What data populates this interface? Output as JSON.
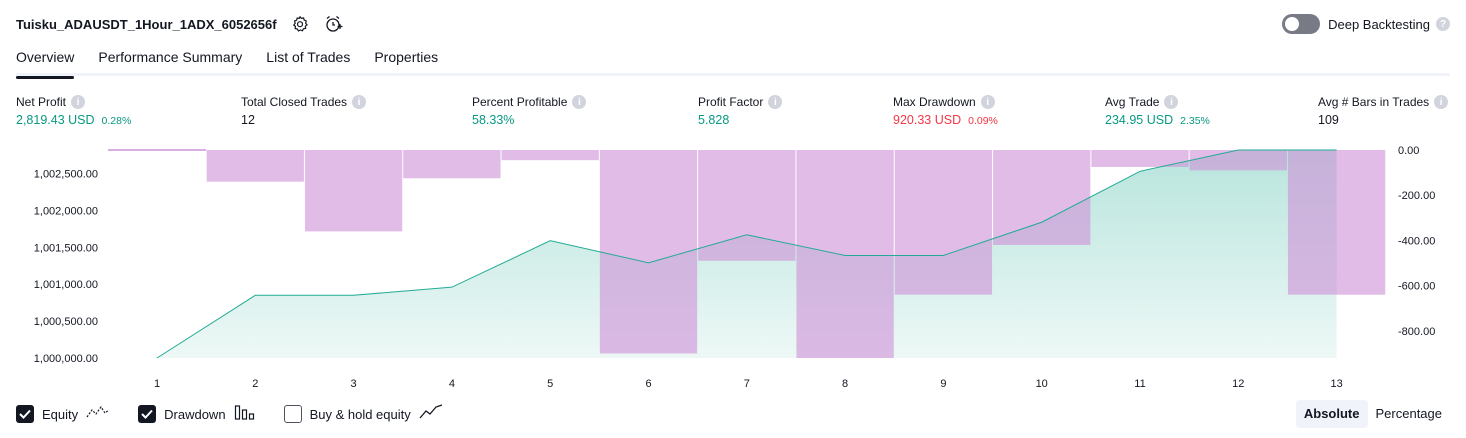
{
  "header": {
    "title": "Tuisku_ADAUSDT_1Hour_1ADX_6052656f",
    "settings_icon": "settings-gear-icon",
    "alert_icon": "add-alert-clock-icon"
  },
  "deep_backtesting": {
    "label": "Deep Backtesting",
    "enabled": false,
    "help": "?"
  },
  "tabs": [
    {
      "label": "Overview",
      "active": true
    },
    {
      "label": "Performance Summary",
      "active": false
    },
    {
      "label": "List of Trades",
      "active": false
    },
    {
      "label": "Properties",
      "active": false
    }
  ],
  "metrics": {
    "net_profit": {
      "label": "Net Profit",
      "value": "2,819.43 USD",
      "percent": "0.28%",
      "info": "i"
    },
    "total_closed_trades": {
      "label": "Total Closed Trades",
      "value": "12",
      "info": "i"
    },
    "percent_profitable": {
      "label": "Percent Profitable",
      "value": "58.33%",
      "info": "i"
    },
    "profit_factor": {
      "label": "Profit Factor",
      "value": "5.828",
      "info": "i"
    },
    "max_drawdown": {
      "label": "Max Drawdown",
      "value": "920.33 USD",
      "percent": "0.09%",
      "info": "i"
    },
    "avg_trade": {
      "label": "Avg Trade",
      "value": "234.95 USD",
      "percent": "2.35%",
      "info": "i"
    },
    "avg_bars": {
      "label": "Avg # Bars in Trades",
      "value": "109",
      "info": "i"
    }
  },
  "colors": {
    "positive": "#089981",
    "negative": "#f23645",
    "equity_line": "#22ab94",
    "drawdown_bar": "#ce93d8"
  },
  "chart_data": {
    "type": "area",
    "x": [
      1,
      2,
      3,
      4,
      5,
      6,
      7,
      8,
      9,
      10,
      11,
      12,
      13
    ],
    "series": [
      {
        "name": "Equity",
        "type": "area",
        "axis": "left",
        "values": [
          1000000,
          1000850,
          1000850,
          1000960,
          1001590,
          1001290,
          1001670,
          1001390,
          1001390,
          1001840,
          1002530,
          1002819,
          1002819
        ]
      },
      {
        "name": "Drawdown",
        "type": "bar",
        "axis": "right",
        "values": [
          0,
          -140,
          -360,
          -125,
          -45,
          -900,
          -490,
          -920,
          -640,
          -420,
          -75,
          -90,
          -640
        ]
      }
    ],
    "left_axis": {
      "ticks": [
        "1,000,000.00",
        "1,000,500.00",
        "1,001,000.00",
        "1,001,500.00",
        "1,002,000.00",
        "1,002,500.00"
      ],
      "range": [
        1000000,
        1002819
      ]
    },
    "right_axis": {
      "ticks": [
        "0.00",
        "-200.00",
        "-400.00",
        "-600.00",
        "-800.00"
      ],
      "range": [
        -920,
        0
      ]
    },
    "x_ticks": [
      "1",
      "2",
      "3",
      "4",
      "5",
      "6",
      "7",
      "8",
      "9",
      "10",
      "11",
      "12",
      "13"
    ],
    "grid": false
  },
  "legend": {
    "equity": {
      "label": "Equity",
      "checked": true,
      "icon": "equity-line-icon"
    },
    "drawdown": {
      "label": "Drawdown",
      "checked": true,
      "icon": "drawdown-bars-icon"
    },
    "buy_hold": {
      "label": "Buy & hold equity",
      "checked": false,
      "icon": "buy-hold-line-icon"
    }
  },
  "mode": {
    "absolute": "Absolute",
    "percentage": "Percentage",
    "selected": "Absolute"
  }
}
